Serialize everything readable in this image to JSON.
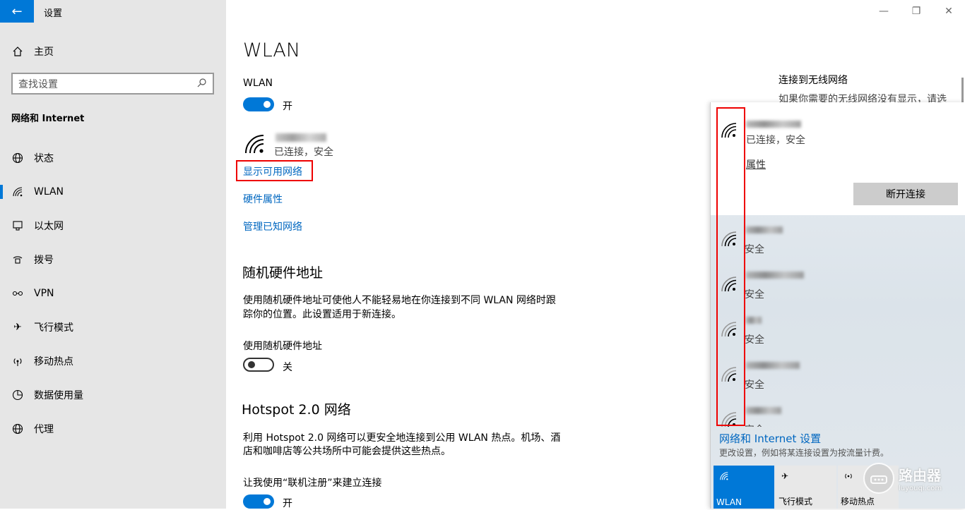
{
  "app": {
    "title": "设置",
    "back_icon": "back-arrow-icon"
  },
  "window_controls": {
    "minimize": "—",
    "maximize": "❐",
    "close": "✕"
  },
  "sidebar": {
    "home_label": "主页",
    "search_placeholder": "查找设置",
    "section_title": "网络和 Internet",
    "items": [
      {
        "label": "状态",
        "icon": "globe-status-icon"
      },
      {
        "label": "WLAN",
        "icon": "wifi-icon",
        "active": true
      },
      {
        "label": "以太网",
        "icon": "ethernet-icon"
      },
      {
        "label": "拨号",
        "icon": "dialup-icon"
      },
      {
        "label": "VPN",
        "icon": "vpn-icon"
      },
      {
        "label": "飞行模式",
        "icon": "airplane-icon"
      },
      {
        "label": "移动热点",
        "icon": "hotspot-icon"
      },
      {
        "label": "数据使用量",
        "icon": "data-usage-icon"
      },
      {
        "label": "代理",
        "icon": "proxy-globe-icon"
      }
    ]
  },
  "main": {
    "title": "WLAN",
    "wlan_label": "WLAN",
    "wlan_toggle": "开",
    "connected_status": "已连接，安全",
    "links": {
      "show_networks": "显示可用网络",
      "hardware_props": "硬件属性",
      "manage_known": "管理已知网络"
    },
    "random_hw": {
      "heading": "随机硬件地址",
      "desc_line1": "使用随机硬件地址可使他人不能轻易地在你连接到不同 WLAN 网络时跟",
      "desc_line2": "踪你的位置。此设置适用于新连接。",
      "toggle_label": "使用随机硬件地址",
      "toggle_state": "关"
    },
    "hotspot20": {
      "heading": "Hotspot 2.0 网络",
      "desc_line1": "利用 Hotspot 2.0 网络可以更安全地连接到公用 WLAN 热点。机场、酒",
      "desc_line2": "店和咖啡店等公共场所中可能会提供这些热点。",
      "toggle_label": "让我使用“联机注册”来建立连接",
      "toggle_state": "开"
    },
    "related": {
      "title": "连接到无线网络",
      "desc": "如果你需要的无线网络没有显示，请选"
    }
  },
  "flyout": {
    "connected_status": "已连接，安全",
    "properties": "属性",
    "disconnect": "断开连接",
    "networks": [
      {
        "security": "安全"
      },
      {
        "security": "安全"
      },
      {
        "security": "安全"
      },
      {
        "security": "安全"
      },
      {
        "security": "安全"
      }
    ],
    "settings_link": "网络和 Internet 设置",
    "settings_desc": "更改设置，例如将某连接设置为按流量计费。",
    "quick_actions": [
      {
        "label": "WLAN",
        "state": "on"
      },
      {
        "label": "飞行模式",
        "state": "off"
      },
      {
        "label": "移动热点",
        "state": "off"
      }
    ]
  },
  "watermark": {
    "name": "路由器",
    "url": "luyouqi.com"
  },
  "colors": {
    "accent": "#0078d7",
    "link": "#0067c0",
    "highlight": "#e00000"
  }
}
